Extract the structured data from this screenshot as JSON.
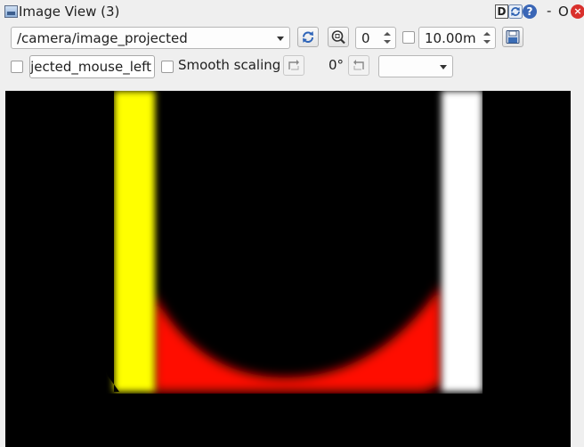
{
  "window": {
    "title": "Image View (3)",
    "d_label": "D",
    "help_label": "?",
    "minimize_label": "-",
    "float_label": "O",
    "close_label": "×"
  },
  "toolbar": {
    "topic": "/camera/image_projected",
    "zoom_value": "0",
    "distance_value": "10.00m",
    "mouse_topic": "ojected_mouse_left",
    "smooth_scaling_label": "Smooth scaling",
    "smooth_scaling_checked": false,
    "rotation_label": "0°",
    "rotation_combo_value": ""
  },
  "image": {
    "left_lane_color": "#ffff00",
    "right_lane_color": "#ffffff",
    "center_fill_color": "#ff0000",
    "background": "#000000"
  }
}
